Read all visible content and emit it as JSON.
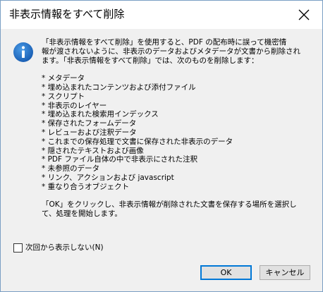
{
  "window": {
    "title": "非表示情報をすべて削除"
  },
  "icons": {
    "close": "close-icon",
    "info": "info-icon"
  },
  "message": {
    "text": "「非表示情報をすべて削除」を使用すると、PDF の配布時に誤って機密情\n報が渡されないように、非表示のデータおよびメタデータが文書から削除され\nます。「非表示情報をすべて削除」では、次のものを削除します：\n\n* メタデータ\n* 埋め込まれたコンテンツおよび添付ファイル\n* スクリプト\n* 非表示のレイヤー\n* 埋め込まれた検索用インデックス\n* 保存されたフォームデータ\n* レビューおよび注釈データ\n* これまでの保存処理で文書に保存された非表示のデータ\n* 隠されたテキストおよび画像\n* PDF ファイル自体の中で非表示にされた注釈\n* 未参照のデータ\n* リンク、アクションおよび javascript\n* 重なり合うオブジェクト\n\n「OK」をクリックし、非表示情報が削除された文書を保存する場所を選択し\nて、処理を開始します。"
  },
  "checkbox": {
    "label": "次回から表示しない(N)",
    "checked": false
  },
  "buttons": {
    "ok": "OK",
    "cancel": "キャンセル"
  },
  "colors": {
    "info_blue": "#1f6fc5",
    "accent": "#0078d7"
  }
}
